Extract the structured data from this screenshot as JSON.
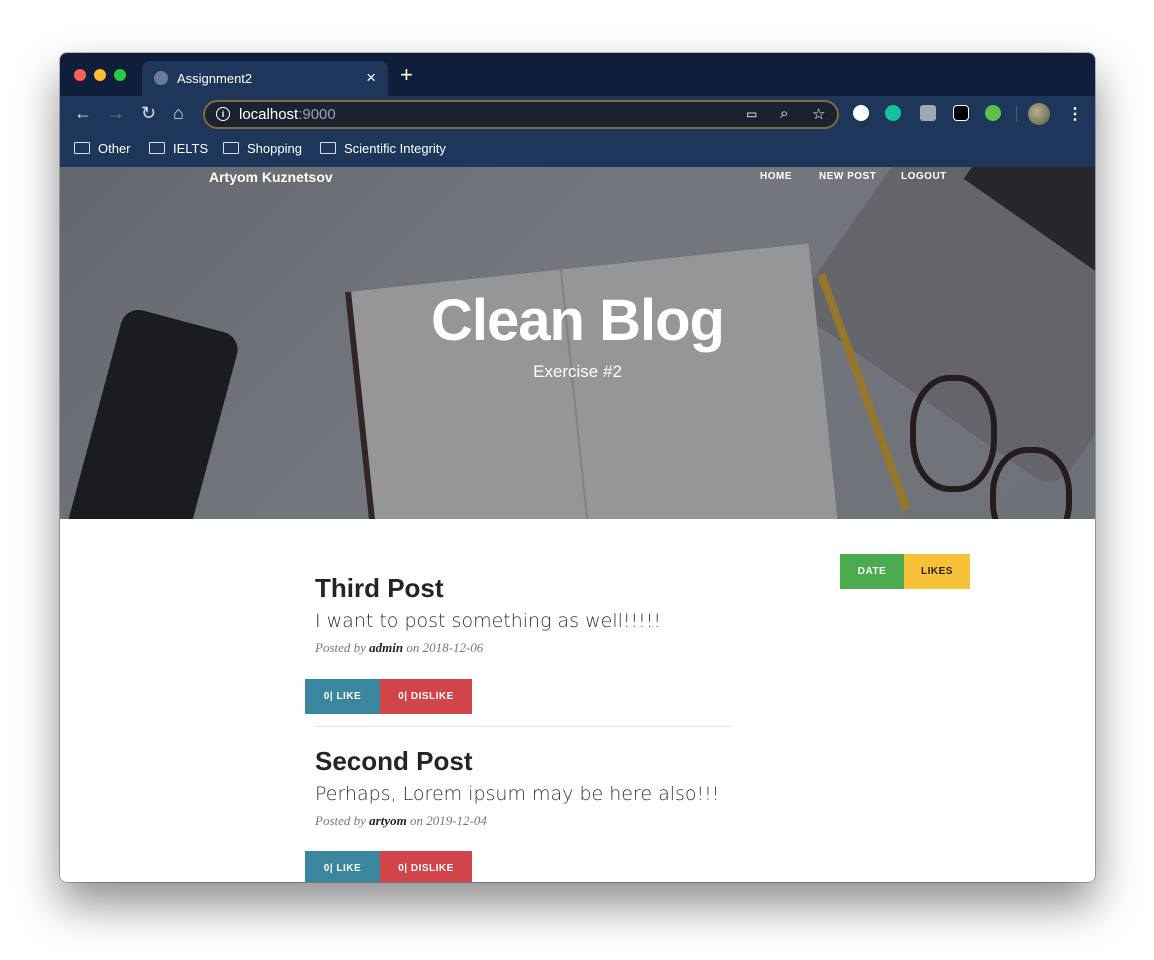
{
  "browser": {
    "tab_title": "Assignment2",
    "tab_close": "×",
    "new_tab": "+",
    "url_host": "localhost",
    "url_port": ":9000",
    "bookmarks": [
      "Other",
      "IELTS",
      "Shopping",
      "Scientific Integrity"
    ]
  },
  "site": {
    "brand": "Artyom Kuznetsov",
    "nav": [
      "HOME",
      "NEW POST",
      "LOGOUT"
    ],
    "hero_title": "Clean Blog",
    "hero_subtitle": "Exercise #2"
  },
  "sort": {
    "date": "DATE",
    "likes": "LIKES"
  },
  "posts": [
    {
      "title": "Third Post",
      "subtitle": "I want to post something as well!!!!!",
      "posted_by": "Posted by",
      "author": "admin",
      "on": "on",
      "date": "2018-12-06",
      "like_label": "0| LIKE",
      "dislike_label": "0| DISLIKE"
    },
    {
      "title": "Second Post",
      "subtitle": "Perhaps, Lorem ipsum may be here also!!!",
      "posted_by": "Posted by",
      "author": "artyom",
      "on": "on",
      "date": "2019-12-04",
      "like_label": "0| LIKE",
      "dislike_label": "0| DISLIKE"
    }
  ],
  "colors": {
    "like": "#3a869e",
    "dislike": "#d1444a",
    "date_button": "#4caa4f",
    "likes_button": "#f7c23a"
  }
}
